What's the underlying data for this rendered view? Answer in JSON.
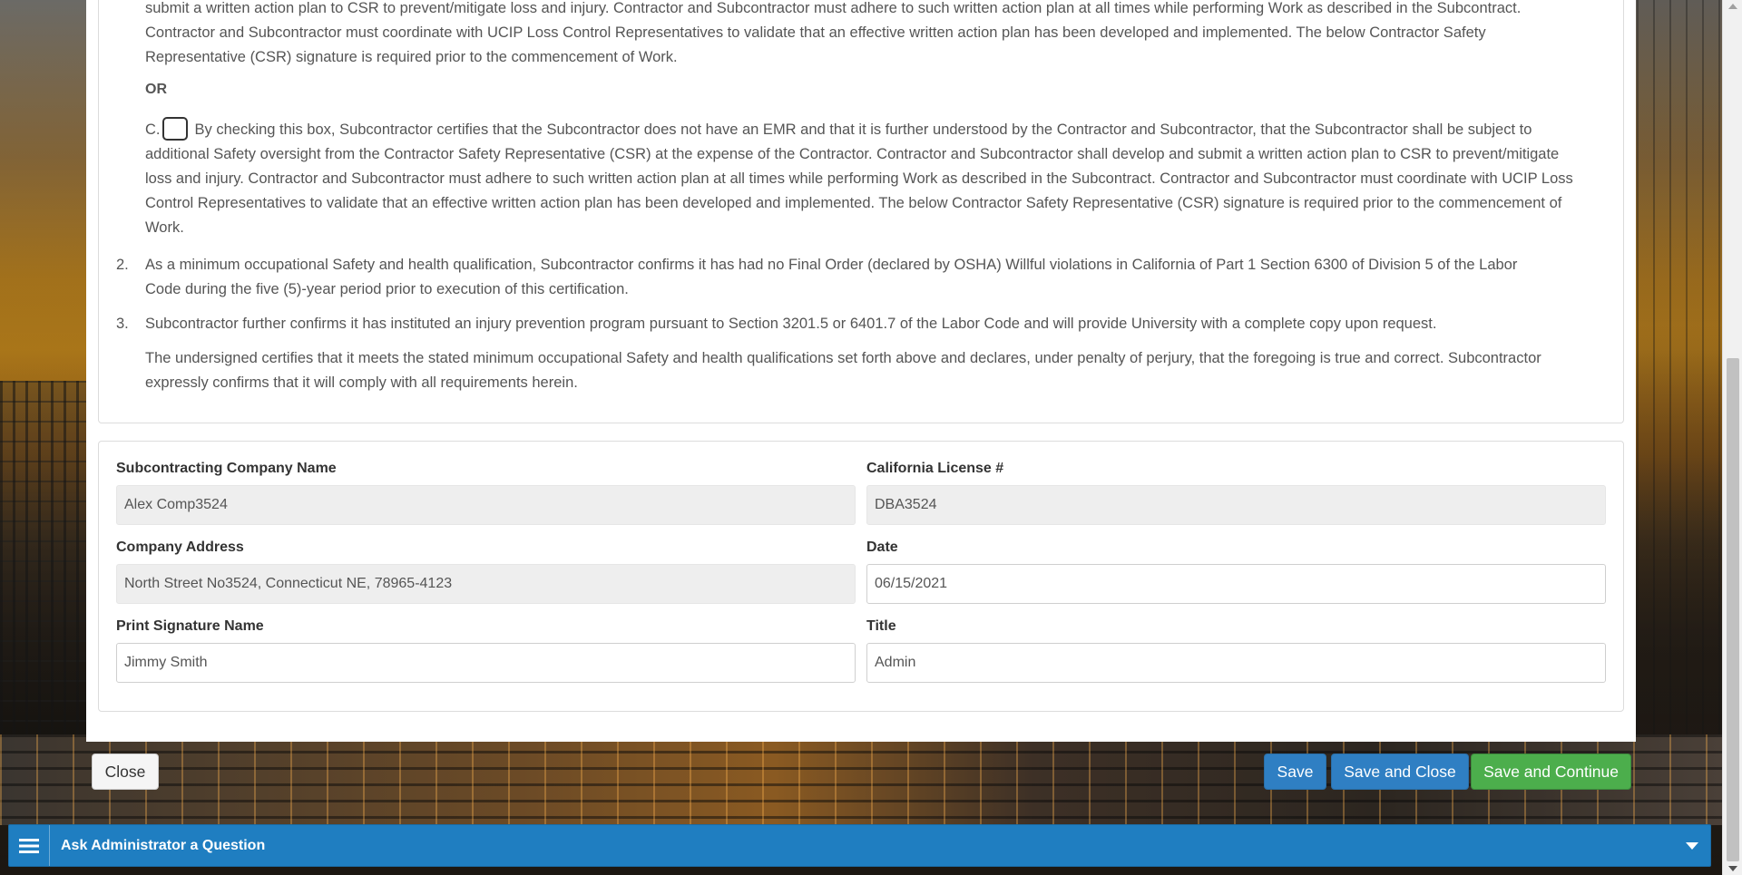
{
  "document": {
    "top_paragraph": "submit a written action plan to CSR to prevent/mitigate loss and injury. Contractor and Subcontractor must adhere to such written action plan at all times while performing Work as described in the Subcontract. Contractor and Subcontractor must coordinate with UCIP Loss Control Representatives to validate that an effective written action plan has been developed and implemented. The below Contractor Safety Representative (CSR) signature is required prior to the commencement of Work.",
    "or_label": "OR",
    "item_c_prefix": "C.",
    "item_c_text": "By checking this box, Subcontractor certifies that the Subcontractor does not have an EMR and that it is further understood by the Contractor and Subcontractor, that the Subcontractor shall be subject to additional Safety oversight from the Contractor Safety Representative (CSR) at the expense of the Contractor. Contractor and Subcontractor shall develop and submit a written action plan to CSR to prevent/mitigate loss and injury. Contractor and Subcontractor must adhere to such written action plan at all times while performing Work as described in the Subcontract. Contractor and Subcontractor must coordinate with UCIP Loss Control Representatives to validate that an effective written action plan has been developed and implemented. The below Contractor Safety Representative (CSR) signature is required prior to the commencement of Work.",
    "item_c_checked": false,
    "item_2_num": "2.",
    "item_2_text": "As a minimum occupational Safety and health qualification, Subcontractor confirms it has had no Final Order (declared by OSHA) Willful violations in California of Part 1 Section 6300 of Division 5 of the Labor Code during the five (5)-year period prior to execution of this certification.",
    "item_3_num": "3.",
    "item_3_text": "Subcontractor further confirms it has instituted an injury prevention program pursuant to Section 3201.5 or 6401.7 of the Labor Code and will provide University with a complete copy upon request.",
    "final_paragraph": "The undersigned certifies that it meets the stated minimum occupational Safety and health qualifications set forth above and declares, under penalty of perjury, that the foregoing is true and correct. Subcontractor expressly confirms that it will comply with all requirements herein."
  },
  "form": {
    "company_name_label": "Subcontracting Company Name",
    "company_name_value": "Alex Comp3524",
    "license_label": "California License #",
    "license_value": "DBA3524",
    "address_label": "Company Address",
    "address_value": "North Street No3524, Connecticut NE, 78965-4123",
    "date_label": "Date",
    "date_value": "06/15/2021",
    "signature_label": "Print Signature Name",
    "signature_value": "Jimmy Smith",
    "title_label": "Title",
    "title_value": "Admin"
  },
  "actions": {
    "close_label": "Close",
    "save_label": "Save",
    "save_close_label": "Save and Close",
    "save_continue_label": "Save and Continue"
  },
  "ask_bar": {
    "title": "Ask Administrator a Question",
    "menu_icon": "hamburger-icon",
    "chevron_icon": "chevron-down-icon"
  },
  "colors": {
    "primary": "#2f7fc3",
    "success": "#4cae4c",
    "ask_bar": "#1f7ec1"
  }
}
